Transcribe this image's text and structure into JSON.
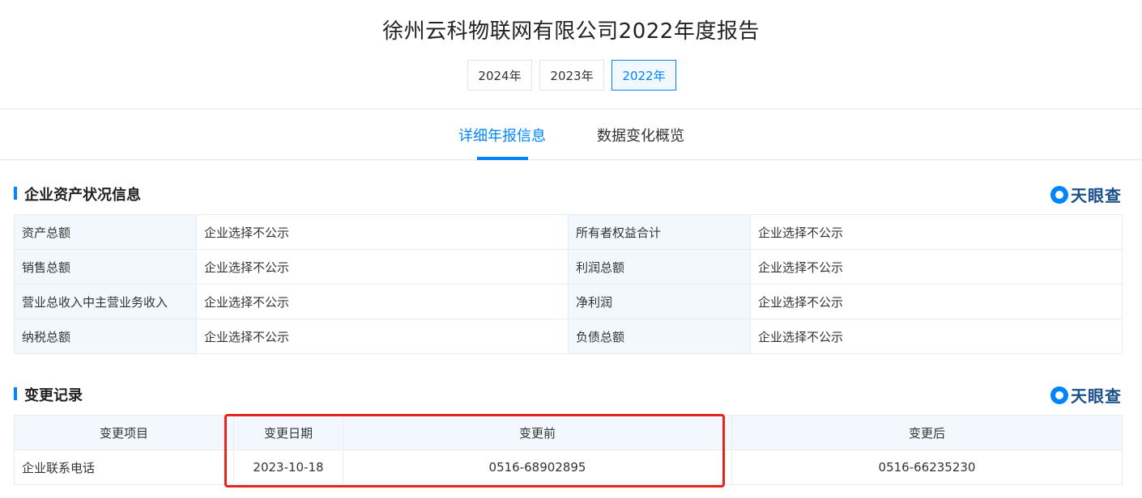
{
  "header": {
    "title": "徐州云科物联网有限公司2022年度报告",
    "years": [
      {
        "label": "2024年",
        "active": false
      },
      {
        "label": "2023年",
        "active": false
      },
      {
        "label": "2022年",
        "active": true
      }
    ]
  },
  "tabs": [
    {
      "label": "详细年报信息",
      "active": true
    },
    {
      "label": "数据变化概览",
      "active": false
    }
  ],
  "brand": {
    "name": "天眼查",
    "icon": "tianyancha-logo-icon"
  },
  "assets": {
    "title": "企业资产状况信息",
    "rows": [
      [
        "资产总额",
        "企业选择不公示",
        "所有者权益合计",
        "企业选择不公示"
      ],
      [
        "销售总额",
        "企业选择不公示",
        "利润总额",
        "企业选择不公示"
      ],
      [
        "营业总收入中主营业务收入",
        "企业选择不公示",
        "净利润",
        "企业选择不公示"
      ],
      [
        "纳税总额",
        "企业选择不公示",
        "负债总额",
        "企业选择不公示"
      ]
    ]
  },
  "changes": {
    "title": "变更记录",
    "headers": [
      "变更项目",
      "变更日期",
      "变更前",
      "变更后"
    ],
    "rows": [
      [
        "企业联系电话",
        "2023-10-18",
        "0516-68902895",
        "0516-66235230"
      ]
    ]
  },
  "colors": {
    "accent": "#0084ff",
    "highlight_box": "#e8231b"
  }
}
